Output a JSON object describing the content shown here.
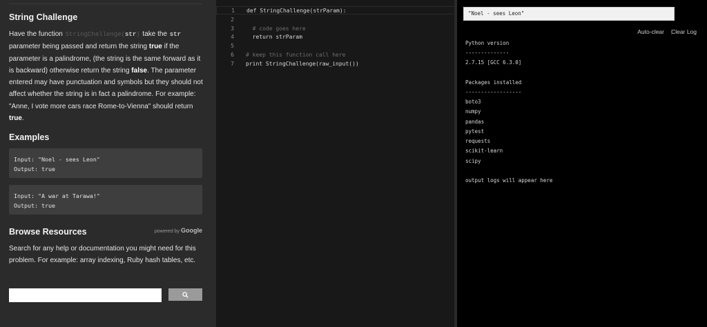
{
  "left_panel": {
    "title": "String Challenge",
    "description": {
      "p1": "Have the function ",
      "fn_name": "StringChallenge(",
      "fn_param": "str",
      "fn_close": ")",
      "p2": " take the ",
      "param_name": "str",
      "p3": " parameter being passed and return the string ",
      "true_word": "true",
      "p4": " if the parameter is a palindrome, (the string is the same forward as it is backward) otherwise return the string ",
      "false_word": "false",
      "p5": ". The parameter entered may have punctuation and symbols but they should not affect whether the string is in fact a palindrome. For example: \"Anne, I vote more cars race Rome-to-Vienna\" should return ",
      "true_word2": "true",
      "p6": "."
    },
    "examples_heading": "Examples",
    "examples": [
      {
        "input": "Input: \"Noel - sees Leon\"",
        "output": "Output: true"
      },
      {
        "input": "Input: \"A war at Tarawa!\"",
        "output": "Output: true"
      }
    ],
    "resources_heading": "Browse Resources",
    "powered_by": "powered by ",
    "powered_brand": "Google",
    "resources_text": "Search for any help or documentation you might need for this problem. For example: array indexing, Ruby hash tables, etc.",
    "search_button_icon": "search-icon"
  },
  "editor": {
    "lines": [
      {
        "num": "1",
        "text": "def StringChallenge(strParam):",
        "comment": false
      },
      {
        "num": "2",
        "text": "",
        "comment": false
      },
      {
        "num": "3",
        "text": "  # code goes here",
        "comment": true
      },
      {
        "num": "4",
        "text": "  return strParam",
        "comment": false
      },
      {
        "num": "5",
        "text": "",
        "comment": false
      },
      {
        "num": "6",
        "text": "# keep this function call here",
        "comment": true
      },
      {
        "num": "7",
        "text": "print StringChallenge(raw_input())",
        "comment": false
      }
    ]
  },
  "console": {
    "stdin_value": "\"Noel - sees Leon\"",
    "auto_clear": "Auto-clear",
    "separator": "|",
    "clear_log": "Clear Log",
    "output": [
      "Python version",
      "--------------",
      "2.7.15 [GCC 6.3.0]",
      "",
      "Packages installed",
      "------------------",
      "boto3",
      "numpy",
      "pandas",
      "pytest",
      "requests",
      "scikit-learn",
      "scipy",
      "",
      "output logs will appear here"
    ]
  }
}
